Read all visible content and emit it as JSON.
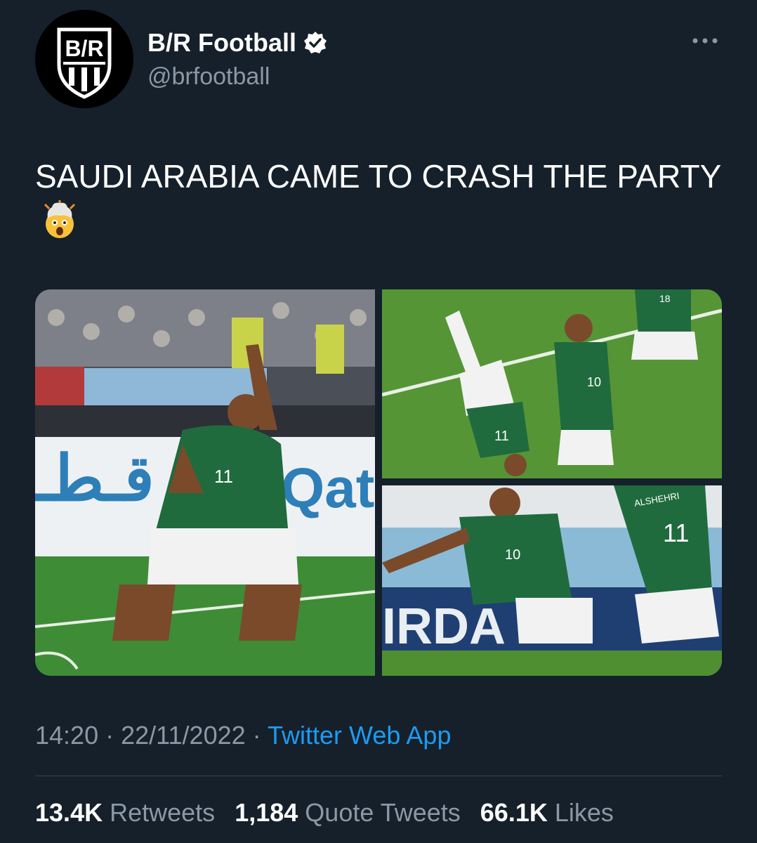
{
  "author": {
    "display_name": "B/R Football",
    "handle": "@brfootball",
    "avatar_icon": "br-football-logo",
    "verified_icon": "verified-badge-icon"
  },
  "more_icon": "more-options-icon",
  "tweet": {
    "text": "SAUDI ARABIA CAME TO CRASH THE PARTY",
    "emoji": "exploding-head-emoji"
  },
  "media": {
    "photos": [
      {
        "id": "photo-1",
        "jersey_number": "11",
        "board_text": "Qata",
        "arabic_text": "قـطـ"
      },
      {
        "id": "photo-2",
        "jersey_number_a": "11",
        "jersey_number_b": "18",
        "jersey_number_c": "10"
      },
      {
        "id": "photo-3",
        "jersey_number_a": "10",
        "jersey_number_b": "11",
        "board_text": "IRDA",
        "shirt_name": "ALSHEHRI"
      }
    ]
  },
  "timestamp": {
    "time": "14:20",
    "separator": "·",
    "date": "22/11/2022",
    "source": "Twitter Web App"
  },
  "stats": {
    "retweets_count": "13.4K",
    "retweets_label": "Retweets",
    "quotes_count": "1,184",
    "quotes_label": "Quote Tweets",
    "likes_count": "66.1K",
    "likes_label": "Likes"
  },
  "colors": {
    "background": "#15202b",
    "secondary_text": "#8b98a5",
    "link": "#1d9bf0",
    "divider": "#38444d",
    "kit_green": "#1f6b3e"
  }
}
